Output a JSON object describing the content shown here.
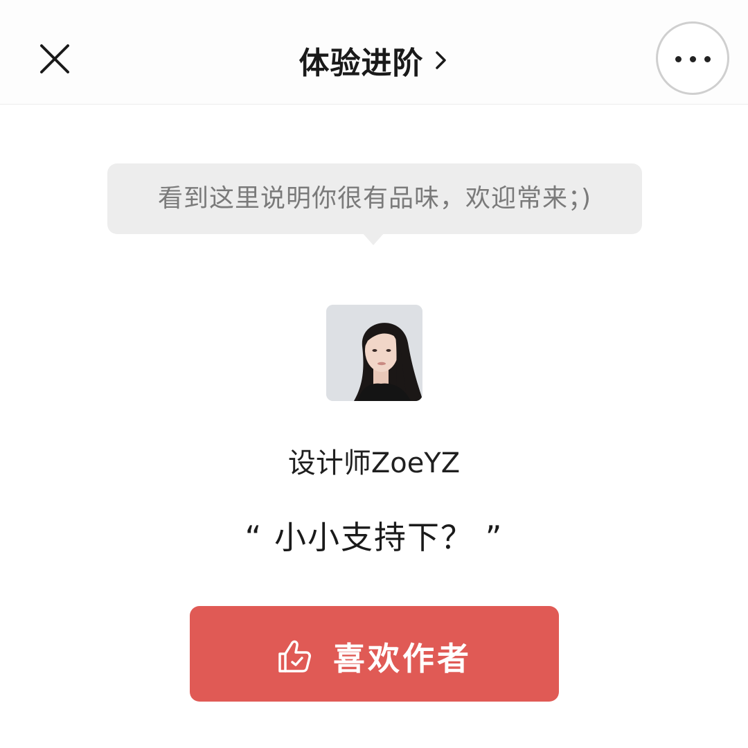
{
  "header": {
    "title": "体验进阶",
    "close_icon": "close-icon",
    "chevron_icon": "chevron-right-icon",
    "more_icon": "more-dots-icon"
  },
  "bubble": {
    "text": "看到这里说明你很有品味，欢迎常来；)"
  },
  "author": {
    "name": "设计师ZoeYZ"
  },
  "quote": {
    "text": "“ 小小支持下？ ”"
  },
  "like_button": {
    "label": "喜欢作者",
    "icon": "thumbs-up-icon",
    "color": "#e05a55"
  }
}
